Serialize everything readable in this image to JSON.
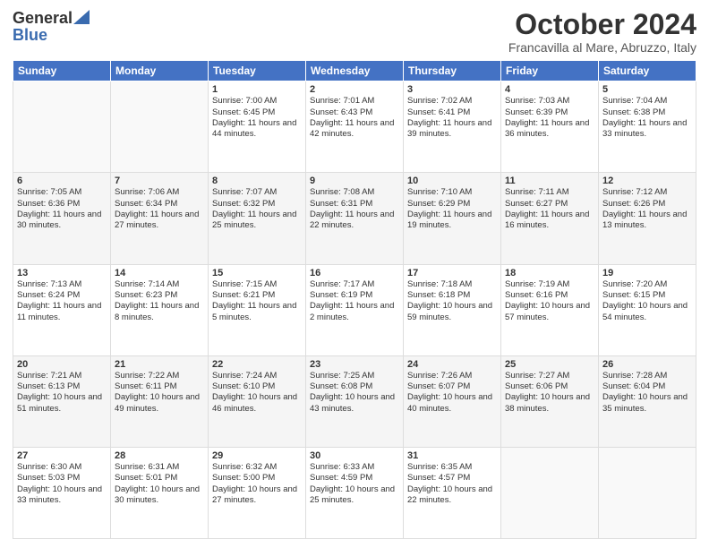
{
  "header": {
    "logo_general": "General",
    "logo_blue": "Blue",
    "month_title": "October 2024",
    "location": "Francavilla al Mare, Abruzzo, Italy"
  },
  "days_of_week": [
    "Sunday",
    "Monday",
    "Tuesday",
    "Wednesday",
    "Thursday",
    "Friday",
    "Saturday"
  ],
  "weeks": [
    [
      {
        "day": "",
        "data": ""
      },
      {
        "day": "",
        "data": ""
      },
      {
        "day": "1",
        "data": "Sunrise: 7:00 AM\nSunset: 6:45 PM\nDaylight: 11 hours and 44 minutes."
      },
      {
        "day": "2",
        "data": "Sunrise: 7:01 AM\nSunset: 6:43 PM\nDaylight: 11 hours and 42 minutes."
      },
      {
        "day": "3",
        "data": "Sunrise: 7:02 AM\nSunset: 6:41 PM\nDaylight: 11 hours and 39 minutes."
      },
      {
        "day": "4",
        "data": "Sunrise: 7:03 AM\nSunset: 6:39 PM\nDaylight: 11 hours and 36 minutes."
      },
      {
        "day": "5",
        "data": "Sunrise: 7:04 AM\nSunset: 6:38 PM\nDaylight: 11 hours and 33 minutes."
      }
    ],
    [
      {
        "day": "6",
        "data": "Sunrise: 7:05 AM\nSunset: 6:36 PM\nDaylight: 11 hours and 30 minutes."
      },
      {
        "day": "7",
        "data": "Sunrise: 7:06 AM\nSunset: 6:34 PM\nDaylight: 11 hours and 27 minutes."
      },
      {
        "day": "8",
        "data": "Sunrise: 7:07 AM\nSunset: 6:32 PM\nDaylight: 11 hours and 25 minutes."
      },
      {
        "day": "9",
        "data": "Sunrise: 7:08 AM\nSunset: 6:31 PM\nDaylight: 11 hours and 22 minutes."
      },
      {
        "day": "10",
        "data": "Sunrise: 7:10 AM\nSunset: 6:29 PM\nDaylight: 11 hours and 19 minutes."
      },
      {
        "day": "11",
        "data": "Sunrise: 7:11 AM\nSunset: 6:27 PM\nDaylight: 11 hours and 16 minutes."
      },
      {
        "day": "12",
        "data": "Sunrise: 7:12 AM\nSunset: 6:26 PM\nDaylight: 11 hours and 13 minutes."
      }
    ],
    [
      {
        "day": "13",
        "data": "Sunrise: 7:13 AM\nSunset: 6:24 PM\nDaylight: 11 hours and 11 minutes."
      },
      {
        "day": "14",
        "data": "Sunrise: 7:14 AM\nSunset: 6:23 PM\nDaylight: 11 hours and 8 minutes."
      },
      {
        "day": "15",
        "data": "Sunrise: 7:15 AM\nSunset: 6:21 PM\nDaylight: 11 hours and 5 minutes."
      },
      {
        "day": "16",
        "data": "Sunrise: 7:17 AM\nSunset: 6:19 PM\nDaylight: 11 hours and 2 minutes."
      },
      {
        "day": "17",
        "data": "Sunrise: 7:18 AM\nSunset: 6:18 PM\nDaylight: 10 hours and 59 minutes."
      },
      {
        "day": "18",
        "data": "Sunrise: 7:19 AM\nSunset: 6:16 PM\nDaylight: 10 hours and 57 minutes."
      },
      {
        "day": "19",
        "data": "Sunrise: 7:20 AM\nSunset: 6:15 PM\nDaylight: 10 hours and 54 minutes."
      }
    ],
    [
      {
        "day": "20",
        "data": "Sunrise: 7:21 AM\nSunset: 6:13 PM\nDaylight: 10 hours and 51 minutes."
      },
      {
        "day": "21",
        "data": "Sunrise: 7:22 AM\nSunset: 6:11 PM\nDaylight: 10 hours and 49 minutes."
      },
      {
        "day": "22",
        "data": "Sunrise: 7:24 AM\nSunset: 6:10 PM\nDaylight: 10 hours and 46 minutes."
      },
      {
        "day": "23",
        "data": "Sunrise: 7:25 AM\nSunset: 6:08 PM\nDaylight: 10 hours and 43 minutes."
      },
      {
        "day": "24",
        "data": "Sunrise: 7:26 AM\nSunset: 6:07 PM\nDaylight: 10 hours and 40 minutes."
      },
      {
        "day": "25",
        "data": "Sunrise: 7:27 AM\nSunset: 6:06 PM\nDaylight: 10 hours and 38 minutes."
      },
      {
        "day": "26",
        "data": "Sunrise: 7:28 AM\nSunset: 6:04 PM\nDaylight: 10 hours and 35 minutes."
      }
    ],
    [
      {
        "day": "27",
        "data": "Sunrise: 6:30 AM\nSunset: 5:03 PM\nDaylight: 10 hours and 33 minutes."
      },
      {
        "day": "28",
        "data": "Sunrise: 6:31 AM\nSunset: 5:01 PM\nDaylight: 10 hours and 30 minutes."
      },
      {
        "day": "29",
        "data": "Sunrise: 6:32 AM\nSunset: 5:00 PM\nDaylight: 10 hours and 27 minutes."
      },
      {
        "day": "30",
        "data": "Sunrise: 6:33 AM\nSunset: 4:59 PM\nDaylight: 10 hours and 25 minutes."
      },
      {
        "day": "31",
        "data": "Sunrise: 6:35 AM\nSunset: 4:57 PM\nDaylight: 10 hours and 22 minutes."
      },
      {
        "day": "",
        "data": ""
      },
      {
        "day": "",
        "data": ""
      }
    ]
  ]
}
